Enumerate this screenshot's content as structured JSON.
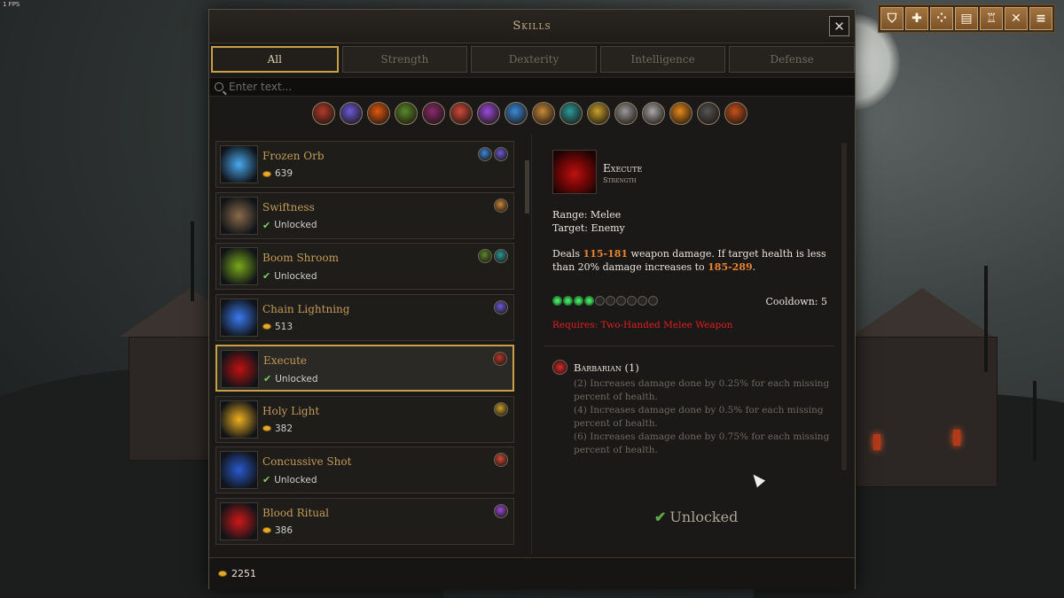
{
  "hud": {
    "fps": "1 FPS"
  },
  "toolbar": {
    "buttons": [
      {
        "name": "character-button",
        "glyph": "⛉"
      },
      {
        "name": "add-button",
        "glyph": "✚"
      },
      {
        "name": "skills-button",
        "glyph": "⁘"
      },
      {
        "name": "journal-button",
        "glyph": "▤"
      },
      {
        "name": "trophy-button",
        "glyph": "♖"
      },
      {
        "name": "crossed-swords-button",
        "glyph": "✕"
      },
      {
        "name": "menu-button",
        "glyph": "≡"
      }
    ]
  },
  "panel": {
    "title": "Skills",
    "close_glyph": "✕",
    "tabs": [
      "All",
      "Strength",
      "Dexterity",
      "Intelligence",
      "Defense"
    ],
    "active_tab": "All",
    "search_placeholder": "Enter text...",
    "filters": [
      {
        "name": "barbarian-filter-icon",
        "color": "#b43a2a"
      },
      {
        "name": "sorcerer-filter-icon",
        "color": "#6a5ad8"
      },
      {
        "name": "fire-filter-icon",
        "color": "#e05a10"
      },
      {
        "name": "druid-filter-icon",
        "color": "#5a8a2a"
      },
      {
        "name": "tome-filter-icon",
        "color": "#8a2a6a"
      },
      {
        "name": "archery-filter-icon",
        "color": "#d04a3a"
      },
      {
        "name": "necro-filter-icon",
        "color": "#9a4ad8"
      },
      {
        "name": "ice-filter-icon",
        "color": "#3a8ad8"
      },
      {
        "name": "hammer-filter-icon",
        "color": "#c88a3a"
      },
      {
        "name": "assassin-filter-icon",
        "color": "#2a9a9a"
      },
      {
        "name": "holy-filter-icon",
        "color": "#c8a02a"
      },
      {
        "name": "knight-filter-icon",
        "color": "#9a9a9a"
      },
      {
        "name": "axe-filter-icon",
        "color": "#a8a8a8"
      },
      {
        "name": "beast-filter-icon",
        "color": "#e88a1a"
      },
      {
        "name": "shadow-filter-icon",
        "color": "#555555"
      },
      {
        "name": "gear-filter-icon",
        "color": "#c8501a"
      }
    ],
    "skills": [
      {
        "name": "Frozen Orb",
        "unlocked": false,
        "cost": "639",
        "status": "",
        "icon": "frozen-orb-icon",
        "icon_color": "#4aa8f0",
        "cats": [
          "#3a8ad8",
          "#6a5ad8"
        ]
      },
      {
        "name": "Swiftness",
        "unlocked": true,
        "cost": "",
        "status": "Unlocked",
        "icon": "swiftness-icon",
        "icon_color": "#8a6a4a",
        "cats": [
          "#c88a3a"
        ]
      },
      {
        "name": "Boom Shroom",
        "unlocked": true,
        "cost": "",
        "status": "Unlocked",
        "icon": "boom-shroom-icon",
        "icon_color": "#7aa81a",
        "cats": [
          "#5a8a2a",
          "#2a9a9a"
        ]
      },
      {
        "name": "Chain Lightning",
        "unlocked": false,
        "cost": "513",
        "status": "",
        "icon": "chain-lightning-icon",
        "icon_color": "#3a7af0",
        "cats": [
          "#6a5ad8"
        ]
      },
      {
        "name": "Execute",
        "unlocked": true,
        "cost": "",
        "status": "Unlocked",
        "icon": "execute-icon",
        "icon_color": "#c01010",
        "cats": [
          "#b43a2a"
        ],
        "selected": true
      },
      {
        "name": "Holy Light",
        "unlocked": false,
        "cost": "382",
        "status": "",
        "icon": "holy-light-icon",
        "icon_color": "#f0b020",
        "cats": [
          "#c8a02a"
        ]
      },
      {
        "name": "Concussive Shot",
        "unlocked": true,
        "cost": "",
        "status": "Unlocked",
        "icon": "concussive-shot-icon",
        "icon_color": "#2a5ad0",
        "cats": [
          "#d04a3a"
        ]
      },
      {
        "name": "Blood Ritual",
        "unlocked": false,
        "cost": "386",
        "status": "",
        "icon": "blood-ritual-icon",
        "icon_color": "#d01818",
        "cats": [
          "#9a4ad8"
        ]
      }
    ],
    "detail": {
      "name": "Execute",
      "category": "Strength",
      "range": "Range: Melee",
      "target": "Target: Enemy",
      "desc_1": "Deals ",
      "desc_dmg": "115-181",
      "desc_2": " weapon damage.  If target health is less than 20% damage increases to ",
      "desc_dmg2": "185-289",
      "desc_3": ".",
      "pips_total": 10,
      "pips_filled": 4,
      "cooldown": "Cooldown: 5",
      "requires": "Requires: Two-Handed Melee Weapon",
      "set_name": "Barbarian (1)",
      "set_bonuses": [
        "(2) Increases damage done by 0.25% for each missing percent of health.",
        "(4) Increases damage done by 0.5% for each missing percent of health.",
        "(6) Increases damage done by 0.75% for each missing percent of health."
      ],
      "unlocked_label": "Unlocked",
      "check_glyph": "✔"
    },
    "footer_gold": "2251"
  }
}
